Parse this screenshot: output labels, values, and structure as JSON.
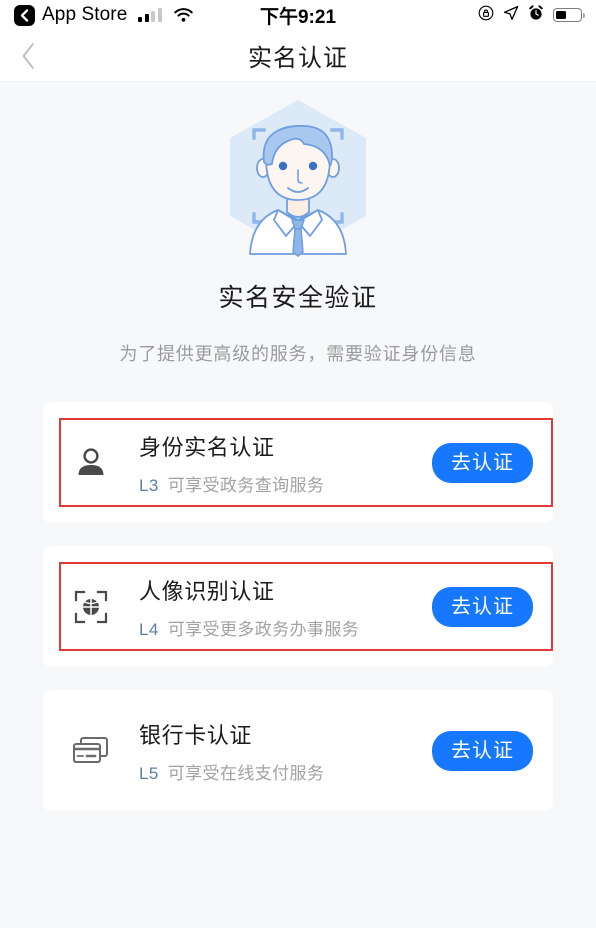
{
  "status_bar": {
    "back_app": "App Store",
    "back_icon": "chevron-left-icon",
    "signal_icon": "cellular-signal-icon",
    "signal_bars_filled": 2,
    "signal_bars_total": 4,
    "wifi_icon": "wifi-icon",
    "time": "下午9:21",
    "rotation_lock_icon": "rotation-lock-icon",
    "location_icon": "location-arrow-icon",
    "alarm_icon": "alarm-clock-icon",
    "battery_icon": "battery-icon",
    "battery_level_percent": 42
  },
  "nav": {
    "back_icon": "chevron-left-icon",
    "title": "实名认证"
  },
  "hero": {
    "illustration_name": "face-scan-avatar-illustration",
    "hex_bg_color": "#dce9f7",
    "line_color": "#6f9fe0",
    "hair_color": "#a9c8f0",
    "headline": "实名安全验证",
    "subline": "为了提供更高级的服务，需要验证身份信息"
  },
  "cards": [
    {
      "icon": "person-icon",
      "title": "身份实名认证",
      "level": "L3",
      "desc": "可享受政务查询服务",
      "button_label": "去认证",
      "highlighted": true
    },
    {
      "icon": "face-recognition-scan-icon",
      "title": "人像识别认证",
      "level": "L4",
      "desc": "可享受更多政务办事服务",
      "button_label": "去认证",
      "highlighted": true
    },
    {
      "icon": "bank-card-icon",
      "title": "银行卡认证",
      "level": "L5",
      "desc": "可享受在线支付服务",
      "button_label": "去认证",
      "highlighted": false
    }
  ],
  "colors": {
    "accent_blue": "#1677ff",
    "highlight_red": "#e03a3a",
    "page_bg": "#f7f8f9",
    "card_bg": "#ffffff",
    "level_text": "#5b7fa8",
    "muted_text": "#a2a2a2"
  }
}
